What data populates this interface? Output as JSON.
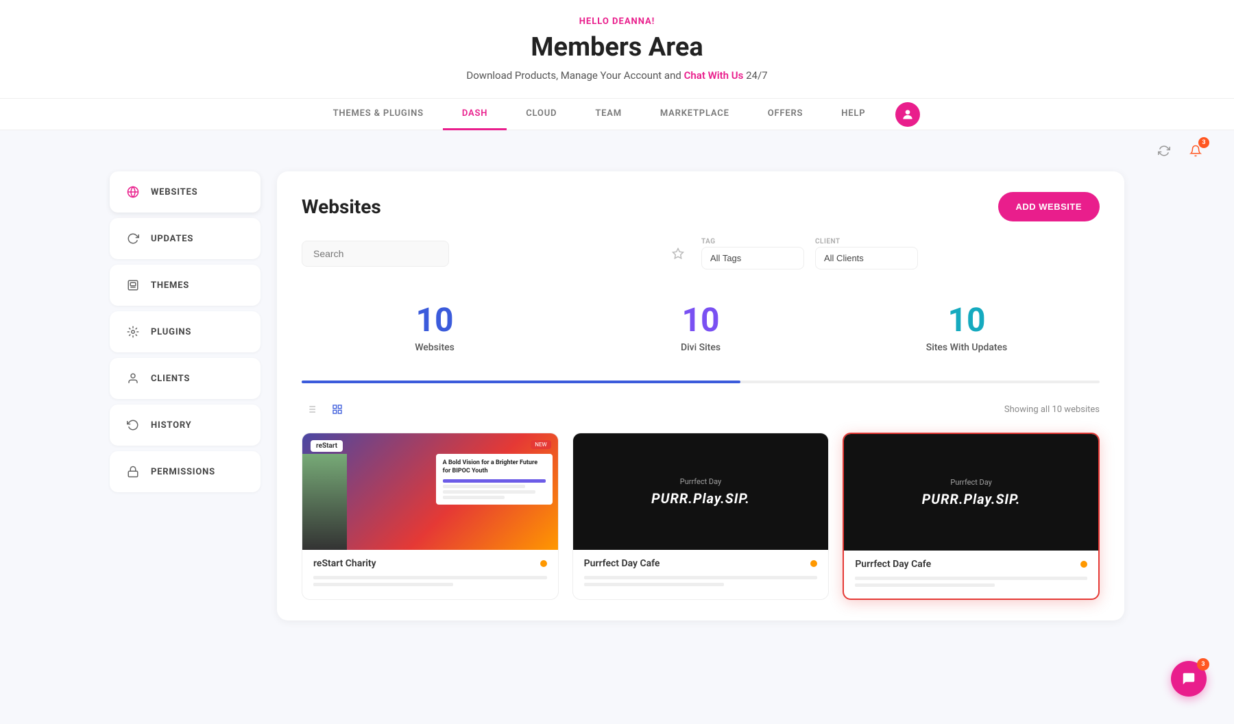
{
  "header": {
    "hello_text": "HELLO DEANNA!",
    "title": "Members Area",
    "subtitle_prefix": "Download Products, Manage Your Account and",
    "chat_link": "Chat With Us",
    "subtitle_suffix": "24/7"
  },
  "nav": {
    "items": [
      {
        "label": "THEMES & PLUGINS",
        "active": false
      },
      {
        "label": "DASH",
        "active": true
      },
      {
        "label": "CLOUD",
        "active": false
      },
      {
        "label": "TEAM",
        "active": false
      },
      {
        "label": "MARKETPLACE",
        "active": false
      },
      {
        "label": "OFFERS",
        "active": false
      },
      {
        "label": "HELP",
        "active": false
      }
    ]
  },
  "toolbar": {
    "refresh_icon": "↻",
    "bell_icon": "🔔",
    "notification_count": "3"
  },
  "sidebar": {
    "items": [
      {
        "id": "websites",
        "label": "WEBSITES",
        "active": true
      },
      {
        "id": "updates",
        "label": "UPDATES",
        "active": false
      },
      {
        "id": "themes",
        "label": "THEMES",
        "active": false
      },
      {
        "id": "plugins",
        "label": "PLUGINS",
        "active": false
      },
      {
        "id": "clients",
        "label": "CLIENTS",
        "active": false
      },
      {
        "id": "history",
        "label": "HISTORY",
        "active": false
      },
      {
        "id": "permissions",
        "label": "PERMISSIONS",
        "active": false
      }
    ]
  },
  "main": {
    "title": "Websites",
    "add_button": "ADD WEBSITE",
    "search_placeholder": "Search",
    "filters": {
      "tag_label": "TAG",
      "tag_default": "All Tags",
      "client_label": "CLIENT",
      "client_default": "All Clients"
    },
    "stats": [
      {
        "number": "10",
        "label": "Websites",
        "color": "stat-blue"
      },
      {
        "number": "10",
        "label": "Divi Sites",
        "color": "stat-purple"
      },
      {
        "number": "10",
        "label": "Sites With Updates",
        "color": "stat-cyan"
      }
    ],
    "showing_text": "Showing all 10 websites",
    "cards": [
      {
        "id": "restart-charity",
        "name": "reStart Charity",
        "type": "restart",
        "status_color": "#ff9800",
        "selected": false
      },
      {
        "id": "purrfect-day-cafe-1",
        "name": "Purrfect Day Cafe",
        "type": "purr",
        "status_color": "#ff9800",
        "selected": false
      },
      {
        "id": "purrfect-day-cafe-2",
        "name": "Purrfect Day Cafe",
        "type": "purr",
        "status_color": "#ff9800",
        "selected": true
      }
    ]
  },
  "chat": {
    "badge": "3"
  }
}
